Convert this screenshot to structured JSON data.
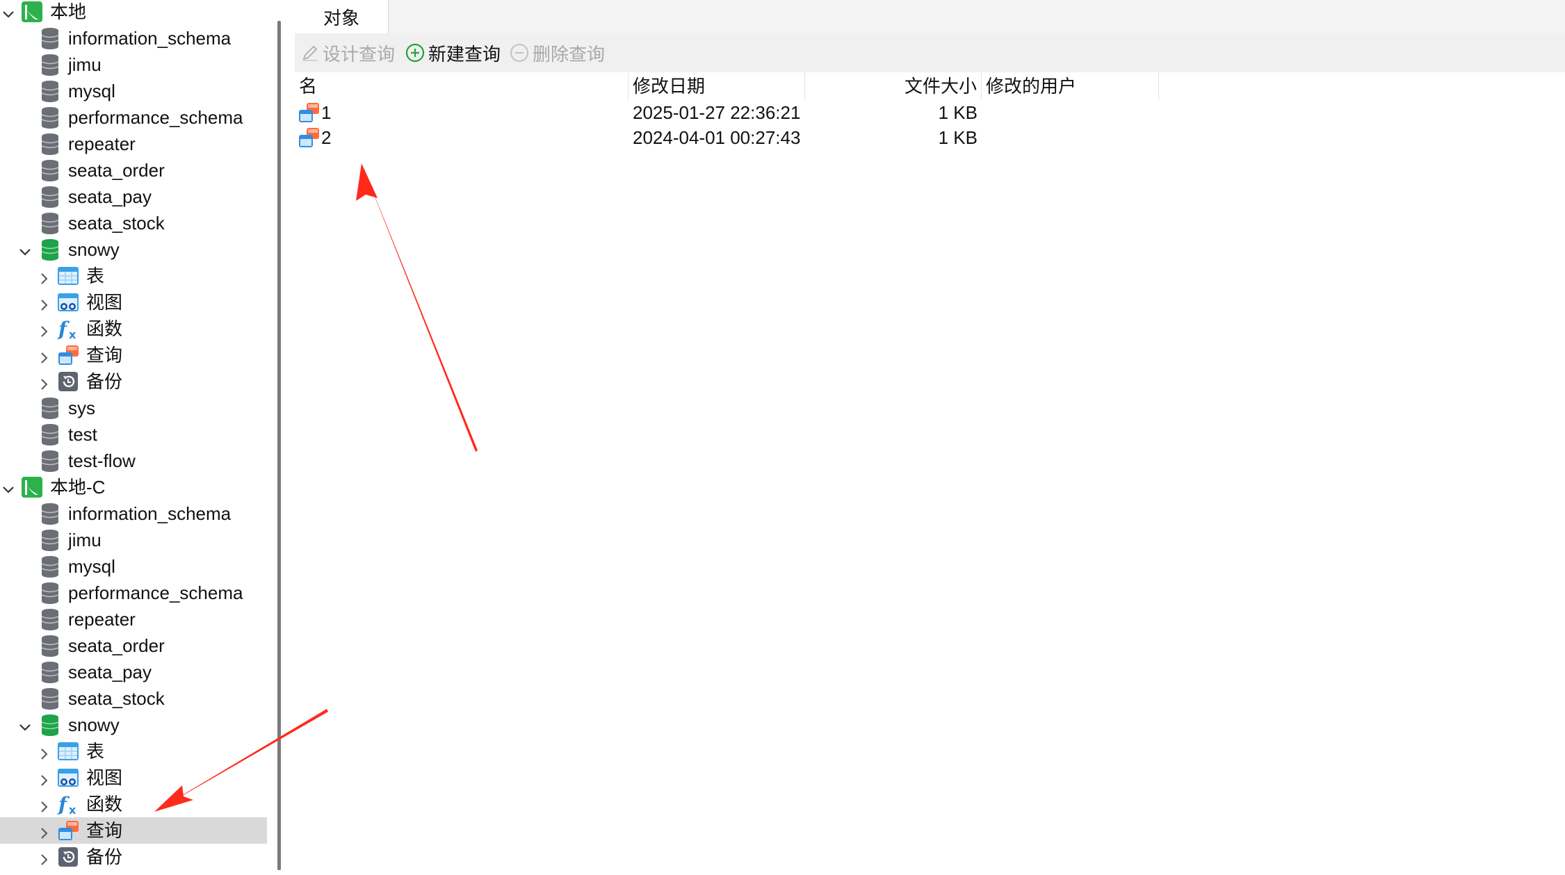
{
  "sidebar": {
    "connections": [
      {
        "name": "本地",
        "databases": [
          {
            "name": "information_schema"
          },
          {
            "name": "jimu"
          },
          {
            "name": "mysql"
          },
          {
            "name": "performance_schema"
          },
          {
            "name": "repeater"
          },
          {
            "name": "seata_order"
          },
          {
            "name": "seata_pay"
          },
          {
            "name": "seata_stock"
          },
          {
            "name": "snowy",
            "expanded": true,
            "children": [
              "表",
              "视图",
              "函数",
              "查询",
              "备份"
            ]
          },
          {
            "name": "sys"
          },
          {
            "name": "test"
          },
          {
            "name": "test-flow"
          }
        ]
      },
      {
        "name": "本地-C",
        "databases": [
          {
            "name": "information_schema"
          },
          {
            "name": "jimu"
          },
          {
            "name": "mysql"
          },
          {
            "name": "performance_schema"
          },
          {
            "name": "repeater"
          },
          {
            "name": "seata_order"
          },
          {
            "name": "seata_pay"
          },
          {
            "name": "seata_stock"
          },
          {
            "name": "snowy",
            "expanded": true,
            "children": [
              "表",
              "视图",
              "函数",
              "查询",
              "备份"
            ],
            "selected_child": "查询"
          }
        ]
      }
    ]
  },
  "tabs": {
    "objects": "对象"
  },
  "toolbar": {
    "design_query": "设计查询",
    "new_query": "新建查询",
    "delete_query": "删除查询"
  },
  "table": {
    "columns": {
      "name": "名",
      "modified": "修改日期",
      "size": "文件大小",
      "user": "修改的用户"
    },
    "rows": [
      {
        "name": "1",
        "modified": "2025-01-27 22:36:21",
        "size": "1 KB",
        "user": ""
      },
      {
        "name": "2",
        "modified": "2024-04-01 00:27:43",
        "size": "1 KB",
        "user": ""
      }
    ]
  },
  "colors": {
    "connection_icon": "#2bb24c",
    "db_icon": "#6b6f75",
    "db_icon_active": "#1fa34a",
    "selection": "#d9d9d9",
    "annotation_arrow": "#ff2a1a",
    "new_query_icon": "#22a33a"
  },
  "icons": {
    "connection": "mysql-connection-icon",
    "database": "database-cylinder-icon",
    "table": "table-icon",
    "view": "view-glasses-icon",
    "function": "fx-function-icon",
    "query": "query-icon",
    "backup": "backup-icon"
  }
}
